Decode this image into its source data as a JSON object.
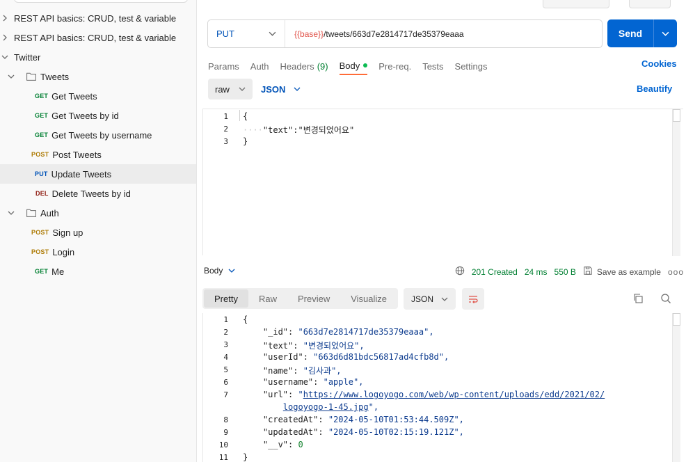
{
  "sidebar": {
    "items": [
      {
        "label": "REST API basics: CRUD, test & variable",
        "kind": "collection",
        "expanded": false
      },
      {
        "label": "REST API basics: CRUD, test & variable",
        "kind": "collection",
        "expanded": false
      },
      {
        "label": "Twitter",
        "kind": "collection",
        "expanded": true
      },
      {
        "label": "Tweets",
        "kind": "folder",
        "expanded": true
      },
      {
        "label": "Get Tweets",
        "method": "GET"
      },
      {
        "label": "Get Tweets by id",
        "method": "GET"
      },
      {
        "label": "Get Tweets by username",
        "method": "GET"
      },
      {
        "label": "Post Tweets",
        "method": "POST"
      },
      {
        "label": "Update Tweets",
        "method": "PUT",
        "selected": true
      },
      {
        "label": "Delete Tweets by id",
        "method": "DEL"
      },
      {
        "label": "Auth",
        "kind": "folder",
        "expanded": true
      },
      {
        "label": "Sign up",
        "method": "POST"
      },
      {
        "label": "Login",
        "method": "POST"
      },
      {
        "label": "Me",
        "method": "GET"
      }
    ]
  },
  "request": {
    "method": "PUT",
    "url_var": "{{base}}",
    "url_path": "/tweets/663d7e2814717de35379eaaa",
    "send_label": "Send",
    "tabs": [
      {
        "label": "Params"
      },
      {
        "label": "Auth"
      },
      {
        "label": "Headers",
        "count": "(9)"
      },
      {
        "label": "Body",
        "active": true
      },
      {
        "label": "Pre-req."
      },
      {
        "label": "Tests"
      },
      {
        "label": "Settings"
      }
    ],
    "cookies_label": "Cookies",
    "body_mode": "raw",
    "body_format": "JSON",
    "beautify_label": "Beautify",
    "body_lines": [
      {
        "n": "1",
        "text": "{"
      },
      {
        "n": "2",
        "key": "\"text\"",
        "value": "\"변경되었어요\""
      },
      {
        "n": "3",
        "text": "}"
      }
    ]
  },
  "response": {
    "body_label": "Body",
    "status": "201 Created",
    "time": "24 ms",
    "size": "550 B",
    "save_label": "Save as example",
    "more_label": "ooo",
    "view_tabs": [
      {
        "label": "Pretty",
        "active": true
      },
      {
        "label": "Raw"
      },
      {
        "label": "Preview"
      },
      {
        "label": "Visualize"
      }
    ],
    "format": "JSON",
    "lines": [
      {
        "n": "1",
        "text": "{"
      },
      {
        "n": "2",
        "key": "\"_id\"",
        "value": "\"663d7e2814717de35379eaaa\","
      },
      {
        "n": "3",
        "key": "\"text\"",
        "value": "\"변경되었어요\","
      },
      {
        "n": "4",
        "key": "\"userId\"",
        "value": "\"663d6d81bdc56817ad4cfb8d\","
      },
      {
        "n": "5",
        "key": "\"name\"",
        "value": "\"김사과\","
      },
      {
        "n": "6",
        "key": "\"username\"",
        "value": "\"apple\","
      },
      {
        "n": "7",
        "key": "\"url\"",
        "value_link": "https://www.logoyogo.com/web/wp-content/uploads/edd/2021/02/",
        "value_q": "\""
      },
      {
        "n": "",
        "cont_link": "logoyogo-1-45.jpg",
        "cont_tail": "\","
      },
      {
        "n": "8",
        "key": "\"createdAt\"",
        "value": "\"2024-05-10T01:53:44.509Z\","
      },
      {
        "n": "9",
        "key": "\"updatedAt\"",
        "value": "\"2024-05-10T02:15:19.121Z\","
      },
      {
        "n": "10",
        "key": "\"__v\"",
        "num": "0"
      },
      {
        "n": "11",
        "text": "}"
      }
    ]
  },
  "colors": {
    "accent": "#0265d2",
    "tab_underline": "#ff6c37",
    "status_ok": "#007f31"
  }
}
